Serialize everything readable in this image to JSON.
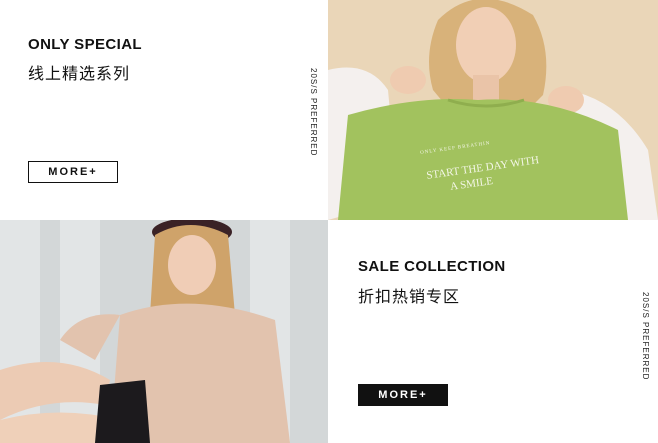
{
  "promo1": {
    "title_en": "ONLY SPECIAL",
    "title_cn": "线上精选系列",
    "vertical_text": "20S/S PREFERRED",
    "button_label": "MORE+"
  },
  "promo2": {
    "shirt_small": "ONLY KEEP BREATHIN",
    "shirt_line1": "START THE DAY WITH",
    "shirt_line2": "A SMILE"
  },
  "promo4": {
    "title_en": "SALE COLLECTION",
    "title_cn": "折扣热销专区",
    "vertical_text": "20S/S PREFERRED",
    "button_label": "MORE+"
  },
  "colors": {
    "background": "#ffffff",
    "text": "#111111",
    "shirt_green": "#9fbf5a",
    "photo1_bg": "#e9d4b4",
    "photo2_bg": "#cfd3d4"
  }
}
